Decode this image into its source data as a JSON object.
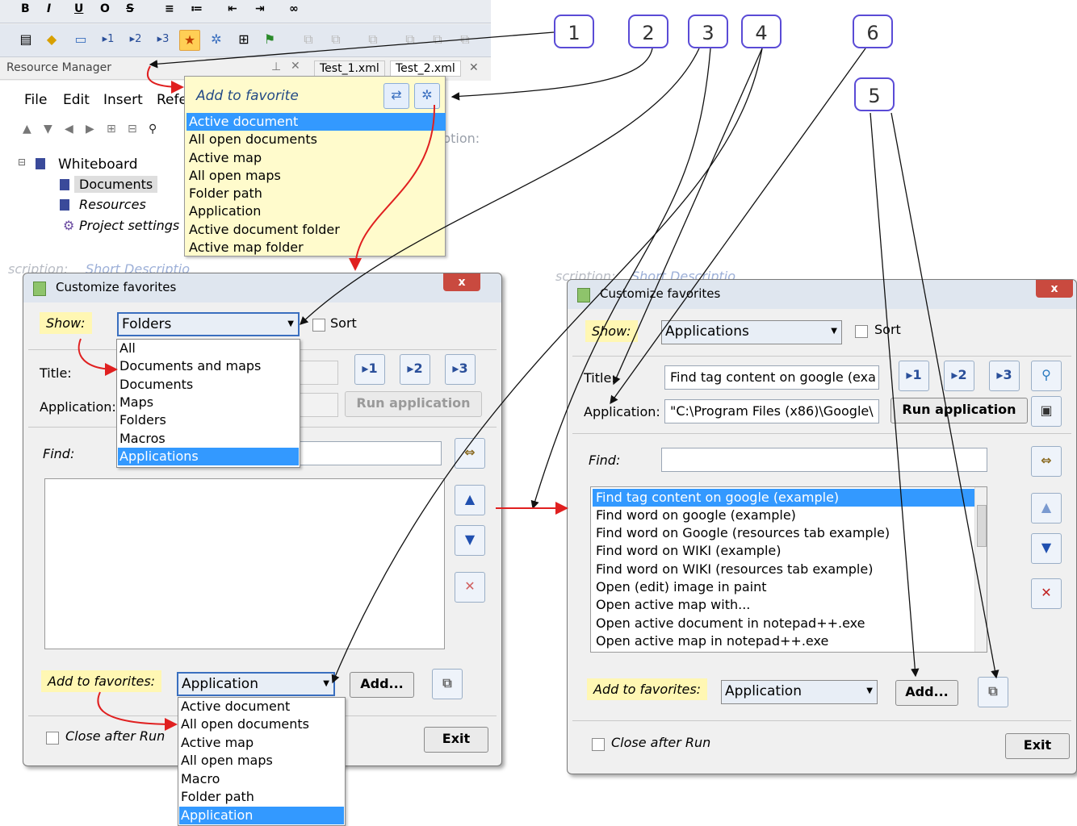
{
  "top": {
    "format_buttons": [
      "B",
      "I",
      "U",
      "O",
      "S",
      "≡",
      "≔",
      "⇤",
      "⇥",
      "∞"
    ],
    "resource_manager": "Resource Manager",
    "doc_tabs": [
      "Test_1.xml",
      "Test_2.xml"
    ],
    "menu": [
      "File",
      "Edit",
      "Insert",
      "Refe"
    ],
    "tree": {
      "root": "Whiteboard",
      "items": [
        "Documents",
        "Resources",
        "Project settings"
      ]
    },
    "ghost_description": "ption:",
    "ghost_short": "Short Descriptio",
    "ghost_cription": "scription:"
  },
  "popup": {
    "title": "Add to favorite",
    "items": [
      "Active document",
      "All open documents",
      "Active map",
      "All open maps",
      "Folder path",
      "Application",
      "Active document folder",
      "Active map folder"
    ],
    "selected_index": 0
  },
  "dialog1": {
    "title": "Customize favorites",
    "show_label": "Show:",
    "show_value": "Folders",
    "sort_label": "Sort",
    "show_options": [
      "All",
      "Documents and maps",
      "Documents",
      "Maps",
      "Folders",
      "Macros",
      "Applications"
    ],
    "title_label": "Title:",
    "application_label": "Application:",
    "slot_buttons": [
      "▸1",
      "▸2",
      "▸3"
    ],
    "run_application": "Run application",
    "find_label": "Find:",
    "add_to_favorites_label": "Add to favorites:",
    "add_value": "Application",
    "add_button": "Add...",
    "add_options": [
      "Active document",
      "All open documents",
      "Active map",
      "All open maps",
      "Macro",
      "Folder path",
      "Application"
    ],
    "close_after_run": "Close after Run",
    "exit": "Exit"
  },
  "dialog2": {
    "title": "Customize favorites",
    "show_label": "Show:",
    "show_value": "Applications",
    "sort_label": "Sort",
    "title_label": "Title:",
    "title_value": "Find tag content on google (exa",
    "application_label": "Application:",
    "application_value": "\"C:\\Program Files (x86)\\Google\\",
    "slot_buttons": [
      "▸1",
      "▸2",
      "▸3"
    ],
    "run_application": "Run application",
    "find_label": "Find:",
    "list": [
      "Find tag content on google (example)",
      "Find word on google (example)",
      "Find word on Google (resources tab example)",
      "Find word on WIKI (example)",
      "Find word on WIKI (resources tab example)",
      "Open (edit) image in paint",
      "Open active map with...",
      "Open active document in notepad++.exe",
      "Open active map in notepad++.exe"
    ],
    "add_to_favorites_label": "Add to favorites:",
    "add_value": "Application",
    "add_button": "Add...",
    "close_after_run": "Close after Run",
    "exit": "Exit"
  },
  "callouts": [
    "1",
    "2",
    "3",
    "4",
    "5",
    "6"
  ]
}
